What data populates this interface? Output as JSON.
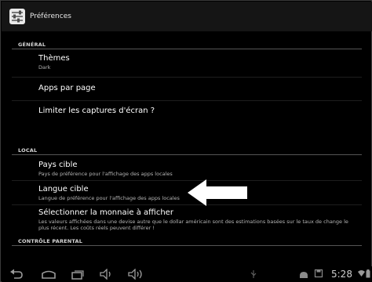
{
  "actionbar": {
    "title": "Préférences",
    "icon": "settings-app-icon"
  },
  "sections": {
    "general": "GÉNÉRAL",
    "local": "LOCAL",
    "parental": "CONTRÔLE PARENTAL"
  },
  "general_items": [
    {
      "title": "Thèmes",
      "summary": "Dark"
    },
    {
      "title": "Apps par page",
      "summary": ""
    },
    {
      "title": "Limiter les captures d'écran ?",
      "summary": ""
    }
  ],
  "local_items": [
    {
      "title": "Pays cible",
      "summary": "Pays de préférence pour l'affichage des apps locales"
    },
    {
      "title": "Langue cible",
      "summary": "Langue de préférence pour l'affichage des apps locales"
    },
    {
      "title": "Sélectionner la monnaie à afficher",
      "summary": "Les valeurs affichées dans une devise autre que le dollar américain sont des estimations basées sur le taux de change le plus récent. Les coûts réels peuvent différer !"
    }
  ],
  "statusbar": {
    "time": "5:28"
  },
  "navbar_icons": [
    "back-icon",
    "home-icon",
    "recent-apps-icon",
    "volume-down-icon",
    "volume-up-icon"
  ],
  "status_icons": [
    "usb-icon",
    "android-icon",
    "storage-icon",
    "wifi-icon",
    "battery-icon"
  ]
}
